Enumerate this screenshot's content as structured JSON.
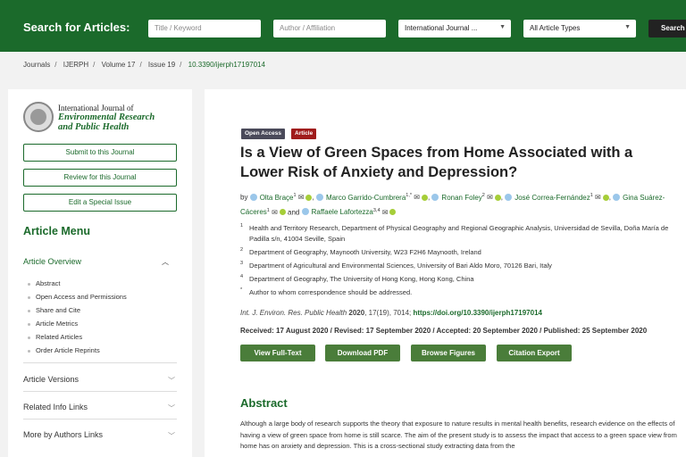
{
  "search_bar": {
    "label": "Search for Articles:",
    "title_placeholder": "Title / Keyword",
    "author_placeholder": "Author / Affiliation",
    "journal_select": "International Journal ...",
    "type_select": "All Article Types",
    "search_button": "Search"
  },
  "breadcrumb": {
    "items": [
      "Journals",
      "IJERPH",
      "Volume 17",
      "Issue 19"
    ],
    "doi": "10.3390/ijerph17197014"
  },
  "sidebar": {
    "journal_line1": "International Journal of",
    "journal_line2": "Environmental Research",
    "journal_line3": "and Public Health",
    "buttons": [
      "Submit to this Journal",
      "Review for this Journal",
      "Edit a Special Issue"
    ],
    "menu_title": "Article Menu",
    "overview_label": "Article Overview",
    "overview_items": [
      "Abstract",
      "Open Access and Permissions",
      "Share and Cite",
      "Article Metrics",
      "Related Articles",
      "Order Article Reprints"
    ],
    "sections": [
      "Article Versions",
      "Related Info Links",
      "More by Authors Links"
    ]
  },
  "article": {
    "badge_open_access": "Open Access",
    "badge_type": "Article",
    "title": "Is a View of Green Spaces from Home Associated with a Lower Risk of Anxiety and Depression?",
    "by": "by",
    "authors": [
      {
        "name": "Olta Braçe",
        "sup": "1"
      },
      {
        "name": "Marco Garrido-Cumbrera",
        "sup": "1,*"
      },
      {
        "name": "Ronan Foley",
        "sup": "2"
      },
      {
        "name": "José Correa-Fernández",
        "sup": "1"
      },
      {
        "name": "Gina Suárez-Cáceres",
        "sup": "1"
      },
      {
        "name": "Raffaele Lafortezza",
        "sup": "3,4"
      }
    ],
    "and": "and",
    "affiliations": [
      {
        "n": "1",
        "text": "Health and Territory Research, Department of Physical Geography and Regional Geographic Analysis, Universidad de Sevilla, Doña María de Padilla s/n, 41004 Seville, Spain"
      },
      {
        "n": "2",
        "text": "Department of Geography, Maynooth University, W23 F2H6 Maynooth, Ireland"
      },
      {
        "n": "3",
        "text": "Department of Agricultural and Environmental Sciences, University of Bari Aldo Moro, 70126 Bari, Italy"
      },
      {
        "n": "4",
        "text": "Department of Geography, The University of Hong Kong, Hong Kong, China"
      },
      {
        "n": "*",
        "text": "Author to whom correspondence should be addressed."
      }
    ],
    "citation_journal": "Int. J. Environ. Res. Public Health",
    "citation_year": "2020",
    "citation_rest": ", 17(19), 7014; ",
    "citation_doi": "https://doi.org/10.3390/ijerph17197014",
    "dates": "Received: 17 August 2020 / Revised: 17 September 2020 / Accepted: 20 September 2020 / Published: 25 September 2020",
    "actions": [
      "View Full-Text",
      "Download PDF",
      "Browse Figures",
      "Citation Export"
    ],
    "abstract_heading": "Abstract",
    "abstract_text": "Although a large body of research supports the theory that exposure to nature results in mental health benefits, research evidence on the effects of having a view of green space from home is still scarce. The aim of the present study is to assess the impact that access to a green space view from home has on anxiety and depression. This is a cross-sectional study extracting data from the"
  },
  "colors": {
    "brand_green": "#1b6a2b",
    "button_green": "#4a7d3a",
    "badge_red": "#a01c1c",
    "badge_dark": "#4a4a5a"
  }
}
